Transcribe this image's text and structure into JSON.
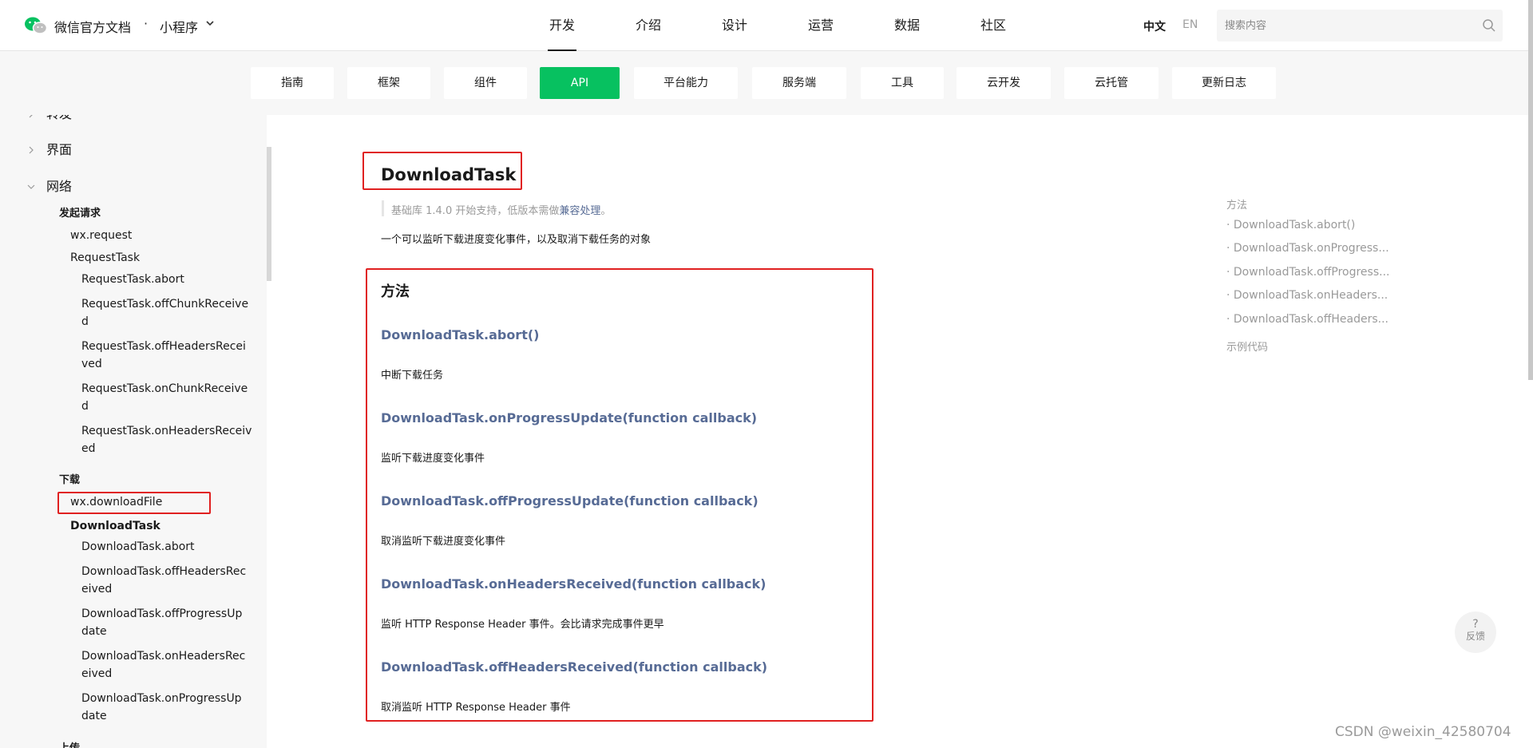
{
  "header": {
    "brand": "微信官方文档",
    "dot": "·",
    "product": "小程序",
    "nav": [
      "开发",
      "介绍",
      "设计",
      "运营",
      "数据",
      "社区"
    ],
    "lang_zh": "中文",
    "lang_en": "EN",
    "search_placeholder": "搜索内容"
  },
  "subnav": {
    "tabs": [
      "指南",
      "框架",
      "组件",
      "API",
      "平台能力",
      "服务端",
      "工具",
      "云开发",
      "云托管",
      "更新日志"
    ],
    "active": "API"
  },
  "sidebar": {
    "partial_top": "转发",
    "ui": "界面",
    "network": "网络",
    "request_group": "发起请求",
    "wx_request": "wx.request",
    "request_task": "RequestTask",
    "request_items": [
      [
        "RequestTask.abort"
      ],
      [
        "RequestTask.offChunkReceive",
        "d"
      ],
      [
        "RequestTask.offHeadersRecei",
        "ved"
      ],
      [
        "RequestTask.onChunkReceive",
        "d"
      ],
      [
        "RequestTask.onHeadersReceiv",
        "ed"
      ]
    ],
    "download_group": "下载",
    "wx_download": "wx.downloadFile",
    "download_task": "DownloadTask",
    "download_items": [
      [
        "DownloadTask.abort"
      ],
      [
        "DownloadTask.offHeadersRec",
        "eived"
      ],
      [
        "DownloadTask.offProgressUp",
        "date"
      ],
      [
        "DownloadTask.onHeadersRec",
        "eived"
      ],
      [
        "DownloadTask.onProgressUp",
        "date"
      ]
    ],
    "partial_bottom": "上传"
  },
  "content": {
    "title": "DownloadTask",
    "note_prefix": "基础库 1.4.0 开始支持，低版本需做",
    "note_link": "兼容处理",
    "note_suffix": "。",
    "description": "一个可以监听下载进度变化事件，以及取消下载任务的对象",
    "methods_heading": "方法",
    "methods": [
      {
        "name": "DownloadTask.abort()",
        "desc": "中断下载任务"
      },
      {
        "name": "DownloadTask.onProgressUpdate(function callback)",
        "desc": "监听下载进度变化事件"
      },
      {
        "name": "DownloadTask.offProgressUpdate(function callback)",
        "desc": "取消监听下载进度变化事件"
      },
      {
        "name": "DownloadTask.onHeadersReceived(function callback)",
        "desc": "监听 HTTP Response Header 事件。会比请求完成事件更早"
      },
      {
        "name": "DownloadTask.offHeadersReceived(function callback)",
        "desc": "取消监听 HTTP Response Header 事件"
      }
    ]
  },
  "toc": {
    "heading": "方法",
    "items": [
      "· DownloadTask.abort()",
      "· DownloadTask.onProgress...",
      "· DownloadTask.offProgress...",
      "· DownloadTask.onHeaders...",
      "· DownloadTask.offHeaders..."
    ],
    "example": "示例代码"
  },
  "feedback": {
    "icon": "?",
    "label": "反馈"
  },
  "watermark": "CSDN @weixin_42580704",
  "colors": {
    "accent": "#07c160",
    "link": "#576b95",
    "highlight": "#e02020"
  }
}
